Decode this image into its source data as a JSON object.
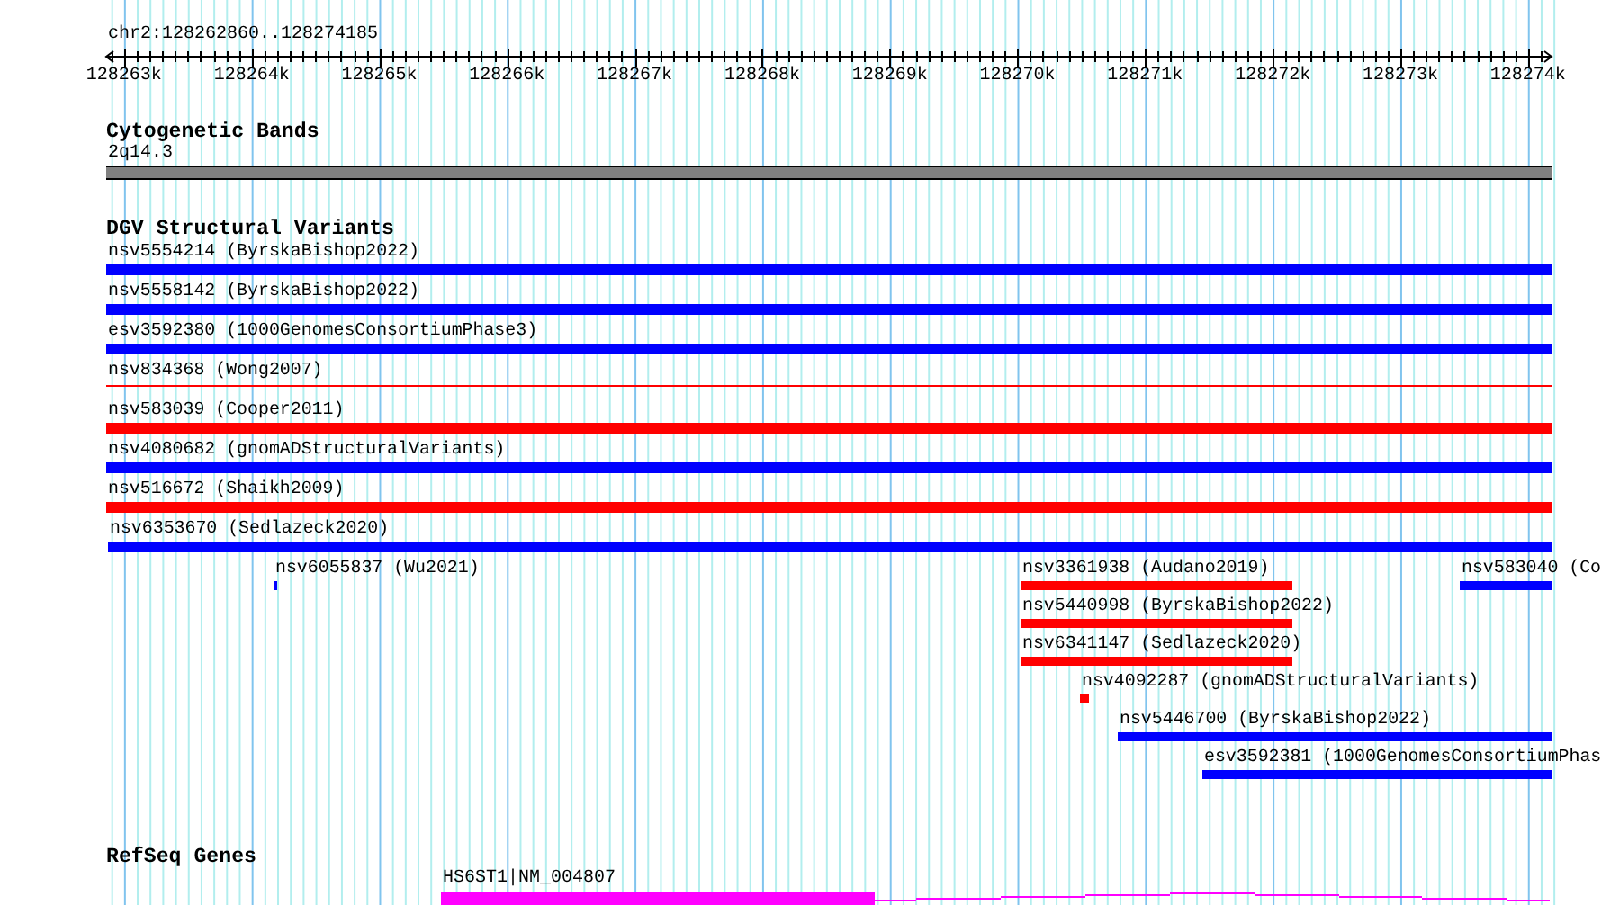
{
  "ruler": {
    "location": "chr2:128262860..128274185",
    "ticks": [
      "128263k",
      "128264k",
      "128265k",
      "128266k",
      "128267k",
      "128268k",
      "128269k",
      "128270k",
      "128271k",
      "128272k",
      "128273k",
      "128274k"
    ]
  },
  "cytogenetic_bands": {
    "title": "Cytogenetic Bands",
    "band": "2q14.3"
  },
  "dgv_structural_variants": {
    "title": "DGV Structural Variants",
    "rows": [
      {
        "features": [
          {
            "label": "nsv5554214 (ByrskaBishop2022)",
            "color": "#0000ff",
            "kind": "bar"
          }
        ]
      },
      {
        "features": [
          {
            "label": "nsv5558142 (ByrskaBishop2022)",
            "color": "#0000ff",
            "kind": "bar"
          }
        ]
      },
      {
        "features": [
          {
            "label": "esv3592380 (1000GenomesConsortiumPhase3)",
            "color": "#0000ff",
            "kind": "bar"
          }
        ]
      },
      {
        "features": [
          {
            "label": "nsv834368 (Wong2007)",
            "color": "#ff0000",
            "kind": "line"
          }
        ]
      },
      {
        "features": [
          {
            "label": "nsv583039 (Cooper2011)",
            "color": "#ff0000",
            "kind": "bar"
          }
        ]
      },
      {
        "features": [
          {
            "label": "nsv4080682 (gnomADStructuralVariants)",
            "color": "#0000ff",
            "kind": "bar"
          }
        ]
      },
      {
        "features": [
          {
            "label": "nsv516672 (Shaikh2009)",
            "color": "#ff0000",
            "kind": "bar"
          }
        ]
      },
      {
        "features": [
          {
            "label": "nsv6353670 (Sedlazeck2020)",
            "color": "#0000ff",
            "kind": "bar"
          }
        ]
      },
      {
        "features": [
          {
            "label": "nsv6055837 (Wu2021)",
            "color": "#0000ff",
            "kind": "bar"
          },
          {
            "label": "nsv3361938 (Audano2019)",
            "color": "#ff0000",
            "kind": "bar"
          },
          {
            "label": "nsv583040 (Co",
            "color": "#0000ff",
            "kind": "bar"
          }
        ]
      },
      {
        "features": [
          {
            "label": "nsv5440998 (ByrskaBishop2022)",
            "color": "#ff0000",
            "kind": "bar"
          }
        ]
      },
      {
        "features": [
          {
            "label": "nsv6341147 (Sedlazeck2020)",
            "color": "#ff0000",
            "kind": "bar"
          }
        ]
      },
      {
        "features": [
          {
            "label": "nsv4092287 (gnomADStructuralVariants)",
            "color": "#ff0000",
            "kind": "bar"
          }
        ]
      },
      {
        "features": [
          {
            "label": "nsv5446700 (ByrskaBishop2022)",
            "color": "#0000ff",
            "kind": "bar"
          }
        ]
      },
      {
        "features": [
          {
            "label": "esv3592381 (1000GenomesConsortiumPhas",
            "color": "#0000ff",
            "kind": "bar"
          }
        ]
      }
    ]
  },
  "refseq_genes": {
    "title": "RefSeq Genes",
    "genes": [
      {
        "label": "HS6ST1|NM_004807"
      }
    ]
  }
}
